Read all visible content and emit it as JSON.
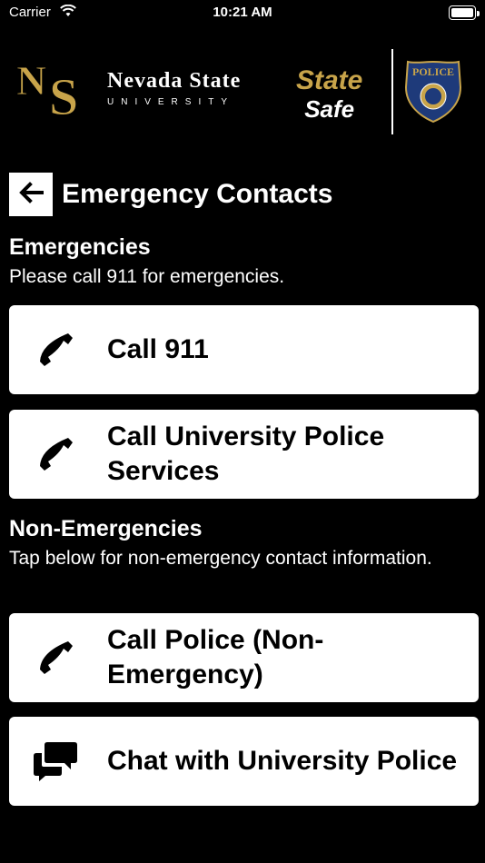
{
  "status_bar": {
    "carrier": "Carrier",
    "time": "10:21 AM"
  },
  "header": {
    "university_line1": "Nevada State",
    "university_line2": "UNIVERSITY",
    "app_line1": "State",
    "app_line2": "Safe",
    "badge_text": "POLICE"
  },
  "page": {
    "title": "Emergency Contacts"
  },
  "sections": [
    {
      "title": "Emergencies",
      "description": "Please call 911 for emergencies.",
      "items": [
        {
          "label": "Call 911",
          "icon": "phone-icon"
        },
        {
          "label": "Call University Police Services",
          "icon": "phone-icon"
        }
      ]
    },
    {
      "title": "Non-Emergencies",
      "description": "Tap below for non-emergency contact information.",
      "items": [
        {
          "label": "Call Police (Non-Emergency)",
          "icon": "phone-icon"
        },
        {
          "label": "Chat with University Police",
          "icon": "chat-bubbles-icon"
        }
      ]
    }
  ],
  "colors": {
    "background": "#000000",
    "card": "#ffffff",
    "gold": "#c8a44a"
  }
}
